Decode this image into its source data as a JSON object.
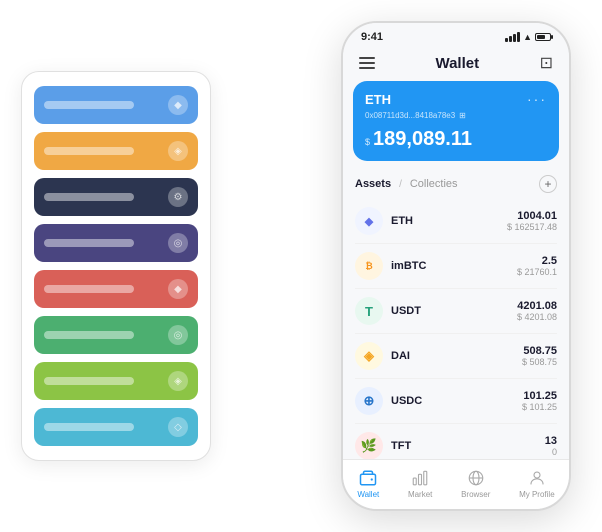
{
  "app": {
    "title": "Wallet",
    "statusBar": {
      "time": "9:41"
    }
  },
  "ethCard": {
    "name": "ETH",
    "address": "0x08711d3d...8418a78e3",
    "balanceLabel": "$",
    "balance": "189,089.11"
  },
  "assets": {
    "tabActive": "Assets",
    "tabDivider": "/",
    "tabInactive": "Collecties",
    "addButton": "+"
  },
  "tokens": [
    {
      "symbol": "ETH",
      "amount": "1004.01",
      "usd": "$ 162517.48",
      "logoText": "◆",
      "logoClass": "eth-logo"
    },
    {
      "symbol": "imBTC",
      "amount": "2.5",
      "usd": "$ 21760.1",
      "logoText": "₿",
      "logoClass": "imbtc-logo"
    },
    {
      "symbol": "USDT",
      "amount": "4201.08",
      "usd": "$ 4201.08",
      "logoText": "T",
      "logoClass": "usdt-logo"
    },
    {
      "symbol": "DAI",
      "amount": "508.75",
      "usd": "$ 508.75",
      "logoText": "◈",
      "logoClass": "dai-logo"
    },
    {
      "symbol": "USDC",
      "amount": "101.25",
      "usd": "$ 101.25",
      "logoText": "⊕",
      "logoClass": "usdc-logo"
    },
    {
      "symbol": "TFT",
      "amount": "13",
      "usd": "0",
      "logoText": "🌿",
      "logoClass": "tft-logo"
    }
  ],
  "bottomNav": [
    {
      "label": "Wallet",
      "active": true
    },
    {
      "label": "Market",
      "active": false
    },
    {
      "label": "Browser",
      "active": false
    },
    {
      "label": "My Profile",
      "active": false
    }
  ],
  "cardStack": [
    {
      "color": "card-blue"
    },
    {
      "color": "card-orange"
    },
    {
      "color": "card-dark"
    },
    {
      "color": "card-purple"
    },
    {
      "color": "card-red"
    },
    {
      "color": "card-green"
    },
    {
      "color": "card-lime"
    },
    {
      "color": "card-sky"
    }
  ]
}
